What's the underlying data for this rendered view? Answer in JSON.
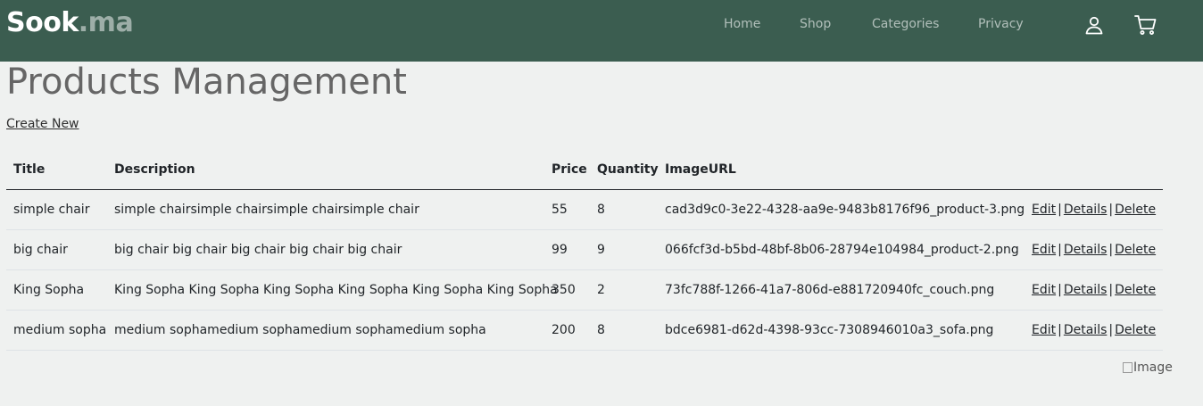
{
  "brand": {
    "main": "Sook",
    "suffix": ".ma"
  },
  "nav": {
    "items": [
      {
        "label": "Home"
      },
      {
        "label": "Shop"
      },
      {
        "label": "Categories"
      },
      {
        "label": "Privacy"
      }
    ],
    "icons": [
      "user-icon",
      "cart-icon"
    ]
  },
  "page": {
    "title": "Products Management",
    "create_link": "Create New"
  },
  "table": {
    "headers": [
      "Title",
      "Description",
      "Price",
      "Quantity",
      "ImageURL",
      ""
    ],
    "rows": [
      {
        "title": "simple chair",
        "description": "simple chairsimple chairsimple chairsimple chair",
        "price": "55",
        "quantity": "8",
        "image_url": "cad3d9c0-3e22-4328-aa9e-9483b8176f96_product-3.png"
      },
      {
        "title": "big chair",
        "description": "big chair big chair big chair big chair big chair",
        "price": "99",
        "quantity": "9",
        "image_url": "066fcf3d-b5bd-48bf-8b06-28794e104984_product-2.png"
      },
      {
        "title": "King Sopha",
        "description": "King Sopha King Sopha King Sopha King Sopha King Sopha King Sopha",
        "price": "350",
        "quantity": "2",
        "image_url": "73fc788f-1266-41a7-806d-e881720940fc_couch.png"
      },
      {
        "title": "medium sopha",
        "description": "medium sophamedium sophamedium sophamedium sopha",
        "price": "200",
        "quantity": "8",
        "image_url": "bdce6981-d62d-4398-93cc-7308946010a3_sofa.png"
      }
    ],
    "actions": {
      "edit": "Edit",
      "details": "Details",
      "delete": "Delete",
      "separator": "|"
    }
  },
  "footer_image": {
    "alt": "Image"
  },
  "colors": {
    "navbar": "#3b5d50",
    "page_bg": "#eff1f0",
    "title": "#666666"
  }
}
